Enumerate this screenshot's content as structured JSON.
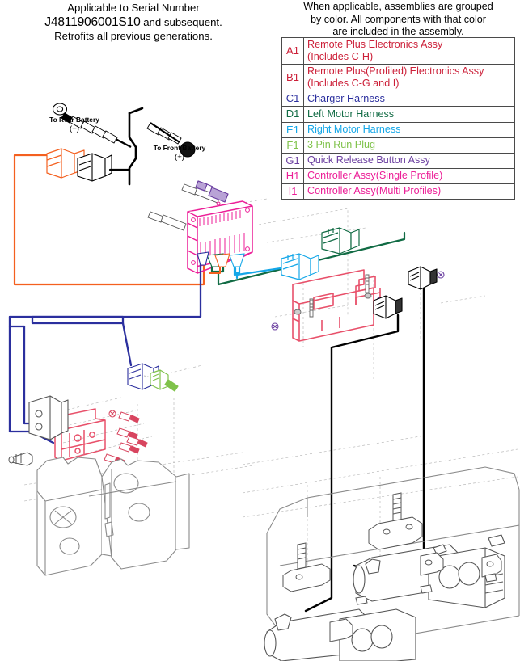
{
  "header_note": {
    "line1": "Applicable to Serial Number",
    "serial": "J4811906001S10",
    "line2_rest": " and subsequent.",
    "line3": "Retrofits all previous generations."
  },
  "legend_note": {
    "line1": "When applicable, assemblies are grouped",
    "line2": "by color. All components with that color",
    "line3": "are included in the assembly."
  },
  "legend_table": {
    "rows": [
      {
        "code": "A1",
        "label": "Remote Plus Electronics Assy\n(Includes C-H)",
        "color": "#cc1f38"
      },
      {
        "code": "B1",
        "label": "Remote Plus(Profiled) Electronics Assy\n(Includes C-G and I)",
        "color": "#cc1f38"
      },
      {
        "code": "C1",
        "label": "Charger Harness",
        "color": "#2b2f9e"
      },
      {
        "code": "D1",
        "label": "Left Motor Harness",
        "color": "#116b44"
      },
      {
        "code": "E1",
        "label": "Right Motor Harness",
        "color": "#14a7e8"
      },
      {
        "code": "F1",
        "label": "3 Pin Run Plug",
        "color": "#7fc24a"
      },
      {
        "code": "G1",
        "label": "Quick Release Button Assy",
        "color": "#6b3fa0"
      },
      {
        "code": "H1",
        "label": "Controller Assy(Single Profile)",
        "color": "#ec1e97"
      },
      {
        "code": "I1",
        "label": "Controller Assy(Multi Profiles)",
        "color": "#ec1e97"
      }
    ]
  },
  "drawing_labels": {
    "rear_battery": "To Rear Battery",
    "rear_battery_sign": "(−)",
    "front_battery": "To Front Battery",
    "front_battery_sign": "(+)"
  },
  "colors": {
    "red_assy": "#cc1f38",
    "navy_charger": "#2b2f9e",
    "green_left_motor": "#116b44",
    "cyan_right_motor": "#14a7e8",
    "lightgreen_runplug": "#7fc24a",
    "purple_quick_release": "#6b3fa0",
    "magenta_controller": "#ec1e97",
    "orange_battery_lead": "#f4601f",
    "black_cable": "#000000",
    "gray_chassis": "#8a8a8a",
    "hidden_line": "#aaaaaa"
  }
}
